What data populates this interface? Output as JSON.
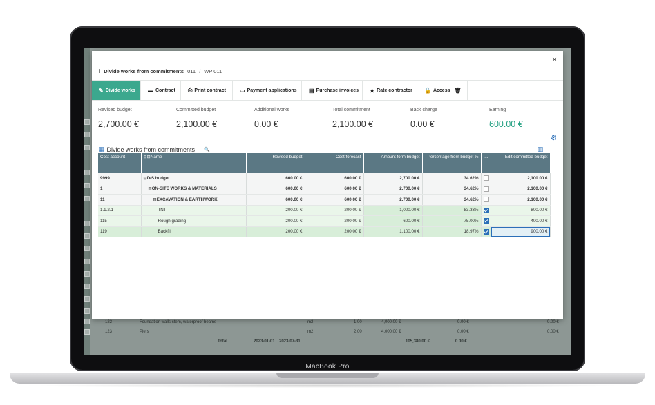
{
  "modal": {
    "close_label": "×",
    "info_icon": "i",
    "title": "Divide works from commitments",
    "crumb_code": "011",
    "crumb_sep": "/",
    "crumb_wp": "WP 011"
  },
  "tabs": [
    {
      "label": "Divide works",
      "icon": "✎"
    },
    {
      "label": "Contract",
      "icon": "▬"
    },
    {
      "label": "Print contract",
      "icon": "⎙"
    },
    {
      "label": "Payment applications",
      "icon": "▭"
    },
    {
      "label": "Purchase invoices",
      "icon": "▤"
    },
    {
      "label": "Rate contractor",
      "icon": "★"
    },
    {
      "label": "Access",
      "icon": "🔓"
    },
    {
      "label": "",
      "icon": "🗑"
    }
  ],
  "stats": [
    {
      "label": "Revised budget",
      "value": "2,700.00 €"
    },
    {
      "label": "Committed budget",
      "value": "2,100.00 €"
    },
    {
      "label": "Additional works",
      "value": "0.00 €"
    },
    {
      "label": "Total commitment",
      "value": "2,100.00 €"
    },
    {
      "label": "Back charge",
      "value": "0.00 €"
    },
    {
      "label": "Earning",
      "value": "600.00 €"
    }
  ],
  "section": {
    "title": "Divide works from commitments"
  },
  "columns": {
    "cost_account": "Cost account",
    "name": "Name",
    "revised_budget": "Revised budget",
    "cost_forecast": "Cost forecast",
    "amount_form_budget": "Amount form budget",
    "percentage_from_budget": "Percentage from budget %",
    "flag": "I...",
    "edit_committed_budget": "Edit committed budget"
  },
  "rows": [
    {
      "account": "9999",
      "name": "D/S budget",
      "revised": "600.00 €",
      "forecast": "600.00 €",
      "amount": "2,700.00 €",
      "percent": "34.62%",
      "edit": "2,100.00 €"
    },
    {
      "account": "1",
      "name": "ON-SITE WORKS & MATERIALS",
      "revised": "600.00 €",
      "forecast": "600.00 €",
      "amount": "2,700.00 €",
      "percent": "34.62%",
      "edit": "2,100.00 €"
    },
    {
      "account": "11",
      "name": "EXCAVATION & EARTHWORK",
      "revised": "600.00 €",
      "forecast": "600.00 €",
      "amount": "2,700.00 €",
      "percent": "34.62%",
      "edit": "2,100.00 €"
    },
    {
      "account": "1.1.2.1",
      "name": "TNT",
      "revised": "200.00 €",
      "forecast": "200.00 €",
      "amount": "1,000.00 €",
      "percent": "83.33%",
      "edit": "800.00 €"
    },
    {
      "account": "115",
      "name": "Rough grading",
      "revised": "200.00 €",
      "forecast": "200.00 €",
      "amount": "600.00 €",
      "percent": "75.00%",
      "edit": "400.00 €"
    },
    {
      "account": "119",
      "name": "Backfill",
      "revised": "200.00 €",
      "forecast": "200.00 €",
      "amount": "1,100.00 €",
      "percent": "18.97%",
      "edit": "900.00 €"
    }
  ],
  "background": {
    "row1": {
      "id": "122",
      "name": "Foundation walls stem, waterproof beams",
      "unit": "m2",
      "v1": "1.00",
      "v2": "4,000.00 €",
      "v3": "0.00 €",
      "v4": "0.00 €"
    },
    "row2": {
      "id": "123",
      "name": "Piers",
      "unit": "m2",
      "v1": "2.00",
      "v2": "4,000.00 €",
      "v3": "0.00 €",
      "v4": "0.00 €"
    },
    "total": {
      "label": "Total",
      "d1": "2023-01-01",
      "d2": "2023-07-31",
      "sum": "105,380.00 €",
      "zero": "0.00 €"
    }
  },
  "brand": "MacBook Pro",
  "colors": {
    "accent": "#3ba88e",
    "header": "#5b7884",
    "earning": "#25a183",
    "link": "#2b6fb8"
  }
}
